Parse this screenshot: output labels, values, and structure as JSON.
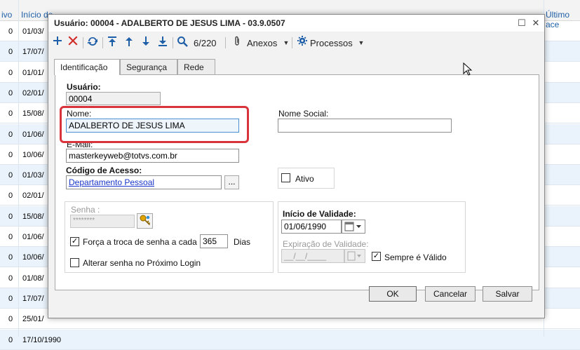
{
  "background": {
    "headers": [
      "ivo",
      "Início de",
      "Último ace"
    ],
    "rows": [
      {
        "c0": "0",
        "c1": "01/03/"
      },
      {
        "c0": "0",
        "c1": "17/07/"
      },
      {
        "c0": "0",
        "c1": "01/01/"
      },
      {
        "c0": "0",
        "c1": "02/01/"
      },
      {
        "c0": "0",
        "c1": "15/08/"
      },
      {
        "c0": "0",
        "c1": "01/06/"
      },
      {
        "c0": "0",
        "c1": "10/06/"
      },
      {
        "c0": "0",
        "c1": "01/03/"
      },
      {
        "c0": "0",
        "c1": "02/01/"
      },
      {
        "c0": "0",
        "c1": "15/08/"
      },
      {
        "c0": "0",
        "c1": "01/06/"
      },
      {
        "c0": "0",
        "c1": "10/06/"
      },
      {
        "c0": "0",
        "c1": "01/08/"
      },
      {
        "c0": "0",
        "c1": "17/07/"
      },
      {
        "c0": "0",
        "c1": "25/01/"
      },
      {
        "c0": "0",
        "c1": "17/10/1990"
      }
    ]
  },
  "dialog": {
    "title": "Usuário: 00004 - ADALBERTO DE JESUS LIMA - 03.9.0507",
    "maximize_glyph": "☐",
    "close_glyph": "✕"
  },
  "toolbar": {
    "record_counter": "6/220",
    "anexos_label": "Anexos",
    "processos_label": "Processos"
  },
  "tabs": [
    {
      "label": "Identificação",
      "active": true
    },
    {
      "label": "Segurança",
      "active": false
    },
    {
      "label": "Rede",
      "active": false
    }
  ],
  "form": {
    "usuario_label": "Usuário:",
    "usuario_value": "00004",
    "nome_label": "Nome:",
    "nome_value": "ADALBERTO DE JESUS LIMA",
    "nome_social_label": "Nome Social:",
    "nome_social_value": "",
    "email_label": "E-Mail:",
    "email_value": "masterkeyweb@totvs.com.br",
    "codigo_acesso_label": "Código de Acesso:",
    "codigo_acesso_value": "Departamento Pessoal",
    "browse_label": "...",
    "ativo_label": "Ativo",
    "ativo_checked": false,
    "senha_label": "Senha :",
    "senha_value": "********",
    "forca_troca_label": "Força a troca de senha a cada",
    "forca_troca_checked": true,
    "dias_value": "365",
    "dias_label": "Dias",
    "alterar_senha_label": "Alterar senha no Próximo Login",
    "alterar_senha_checked": false,
    "inicio_validade_label": "Início de Validade:",
    "inicio_validade_value": "01/06/1990",
    "expiracao_label": "Expiração de Validade:",
    "expiracao_value": "__/__/____",
    "sempre_valido_label": "Sempre é Válido",
    "sempre_valido_checked": true
  },
  "footer": {
    "ok_label": "OK",
    "cancel_label": "Cancelar",
    "save_label": "Salvar"
  }
}
